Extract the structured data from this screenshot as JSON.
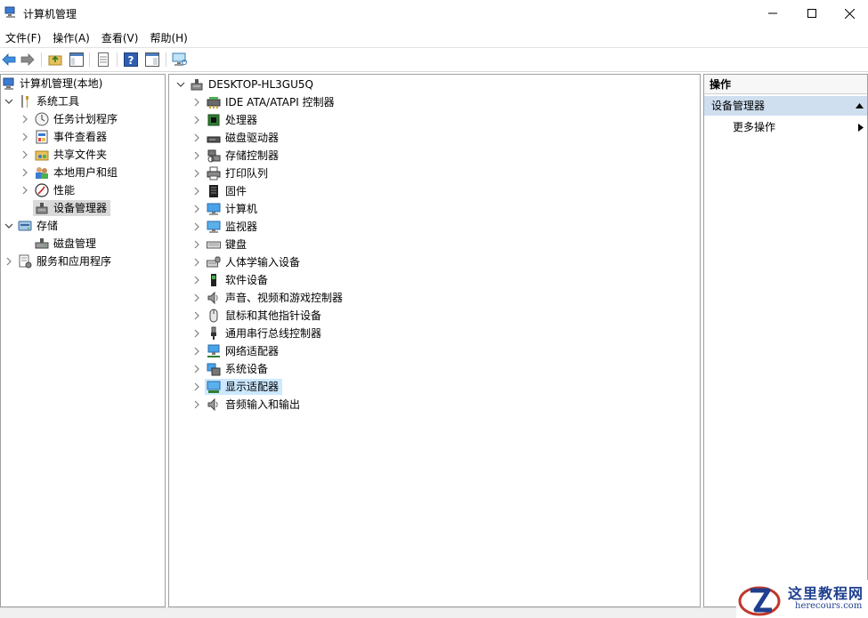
{
  "window": {
    "title": "计算机管理"
  },
  "menu": [
    {
      "label": "文件(F)"
    },
    {
      "label": "操作(A)"
    },
    {
      "label": "查看(V)"
    },
    {
      "label": "帮助(H)"
    }
  ],
  "left_tree": {
    "root": "计算机管理(本地)",
    "items": [
      {
        "label": "系统工具",
        "icon": "tools-icon"
      },
      {
        "label": "任务计划程序",
        "icon": "clock-icon"
      },
      {
        "label": "事件查看器",
        "icon": "event-viewer-icon"
      },
      {
        "label": "共享文件夹",
        "icon": "shared-folder-icon"
      },
      {
        "label": "本地用户和组",
        "icon": "users-icon"
      },
      {
        "label": "性能",
        "icon": "performance-icon"
      },
      {
        "label": "设备管理器",
        "icon": "device-manager-icon"
      },
      {
        "label": "存储",
        "icon": "storage-icon"
      },
      {
        "label": "磁盘管理",
        "icon": "disk-management-icon"
      },
      {
        "label": "服务和应用程序",
        "icon": "services-icon"
      }
    ]
  },
  "device_tree": {
    "computer": "DESKTOP-HL3GU5Q",
    "categories": [
      {
        "label": "IDE ATA/ATAPI 控制器",
        "icon": "ide-controller-icon"
      },
      {
        "label": "处理器",
        "icon": "processor-icon"
      },
      {
        "label": "磁盘驱动器",
        "icon": "disk-drive-icon"
      },
      {
        "label": "存储控制器",
        "icon": "storage-controller-icon"
      },
      {
        "label": "打印队列",
        "icon": "printer-icon"
      },
      {
        "label": "固件",
        "icon": "firmware-icon"
      },
      {
        "label": "计算机",
        "icon": "computer-icon"
      },
      {
        "label": "监视器",
        "icon": "monitor-icon"
      },
      {
        "label": "键盘",
        "icon": "keyboard-icon"
      },
      {
        "label": "人体学输入设备",
        "icon": "hid-icon"
      },
      {
        "label": "软件设备",
        "icon": "software-device-icon"
      },
      {
        "label": "声音、视频和游戏控制器",
        "icon": "speaker-icon"
      },
      {
        "label": "鼠标和其他指针设备",
        "icon": "mouse-icon"
      },
      {
        "label": "通用串行总线控制器",
        "icon": "usb-icon"
      },
      {
        "label": "网络适配器",
        "icon": "network-adapter-icon"
      },
      {
        "label": "系统设备",
        "icon": "system-device-icon"
      },
      {
        "label": "显示适配器",
        "icon": "display-adapter-icon"
      },
      {
        "label": "音频输入和输出",
        "icon": "audio-io-icon"
      }
    ]
  },
  "actions": {
    "header": "操作",
    "section": "设备管理器",
    "more": "更多操作"
  },
  "watermark": {
    "brand_cn": "这里教程网",
    "brand_en": "herecours.com"
  },
  "colors": {
    "selection": "#cce8ff",
    "actions_section": "#cfdff0",
    "brand": "#1f3f8f"
  }
}
